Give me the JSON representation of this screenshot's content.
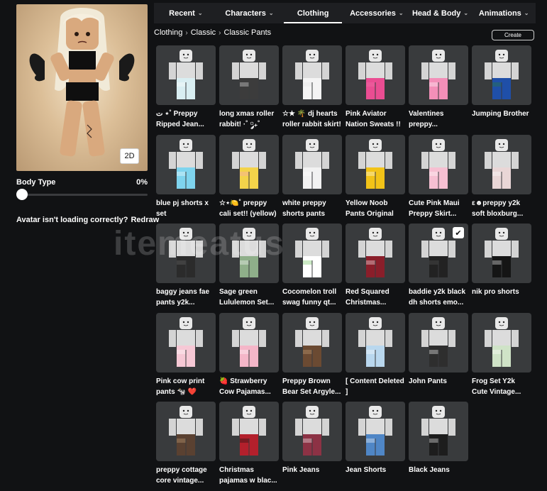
{
  "avatar": {
    "view_toggle": "2D"
  },
  "body_type": {
    "label": "Body Type",
    "value": "0%",
    "level": 0
  },
  "notice": {
    "text": "Avatar isn't loading correctly?",
    "redraw": "Redraw"
  },
  "tabs": [
    {
      "label": "Recent"
    },
    {
      "label": "Characters"
    },
    {
      "label": "Clothing",
      "active": true
    },
    {
      "label": "Accessories"
    },
    {
      "label": "Head & Body"
    },
    {
      "label": "Animations"
    }
  ],
  "breadcrumb": [
    "Clothing",
    "Classic",
    "Classic Pants"
  ],
  "create_label": "Create",
  "items": [
    {
      "name": "ت ⋆˚ Preppy Ripped Jean...",
      "colors": [
        "#d9eef2",
        "#ffffff"
      ]
    },
    {
      "name": "long xmas roller rabbit! ·˚ ༘₊˚",
      "colors": [
        "#3c3c3c",
        "#e8e8e8"
      ]
    },
    {
      "name": "☆★ 🌴 dj hearts roller rabbit skirt!",
      "colors": [
        "#f4f4f4",
        "#e2e2e2"
      ]
    },
    {
      "name": "Pink Aviator Nation Sweats !!",
      "colors": [
        "#ea4d92",
        "#f070a8"
      ]
    },
    {
      "name": "Valentines preppy...",
      "colors": [
        "#f38fb8",
        "#ffffff"
      ]
    },
    {
      "name": "Jumping Brother",
      "colors": [
        "#1f4fa8",
        "#2e7d32"
      ]
    },
    {
      "name": "blue pj shorts x set",
      "colors": [
        "#7fd4ee",
        "#ffffff"
      ]
    },
    {
      "name": "☆⋆🍋˚ preppy cali set!! (yellow)",
      "colors": [
        "#f3d34a",
        "#f6a3c1"
      ]
    },
    {
      "name": "white preppy shorts pants",
      "colors": [
        "#f2f2f2",
        "#ffffff"
      ]
    },
    {
      "name": "Yellow Noob Pants Original",
      "colors": [
        "#f2c318",
        "#ffffff"
      ]
    },
    {
      "name": "Cute Pink Maui Preppy Skirt...",
      "colors": [
        "#f6bfd2",
        "#ffffff"
      ]
    },
    {
      "name": "ε☻preppy y2k soft bloxburg...",
      "colors": [
        "#e9d6d6",
        "#ffffff"
      ]
    },
    {
      "name": "baggy jeans fae pants y2k...",
      "colors": [
        "#2b2b2b",
        "#6a6a6a"
      ]
    },
    {
      "name": "Sage green Lululemon Set...",
      "colors": [
        "#8faf8a",
        "#ffffff"
      ]
    },
    {
      "name": "Cocomelon troll swag funny qt...",
      "colors": [
        "#ffffff",
        "#6bbf59"
      ]
    },
    {
      "name": "Red Squared Christmas...",
      "colors": [
        "#8a1e2a",
        "#ffffff"
      ]
    },
    {
      "name": "baddie y2k black dh shorts emo...",
      "colors": [
        "#222222",
        "#555555"
      ],
      "selected": true
    },
    {
      "name": "nik pro shorts",
      "colors": [
        "#151515",
        "#ffffff"
      ]
    },
    {
      "name": "Pink cow print pants 🐄 ❤️",
      "colors": [
        "#f6c8d5",
        "#ffffff"
      ]
    },
    {
      "name": "🍓 Strawberry Cow Pajamas...",
      "colors": [
        "#f4b6c8",
        "#ffffff"
      ]
    },
    {
      "name": "Preppy Brown Bear Set Argyle...",
      "colors": [
        "#6b4a32",
        "#c9a37a"
      ]
    },
    {
      "name": "[ Content Deleted ]",
      "colors": [
        "#b9d7ee",
        "#ffffff"
      ]
    },
    {
      "name": "John Pants",
      "colors": [
        "#2e2e2e",
        "#ffffff"
      ]
    },
    {
      "name": "Frog Set Y2k Cute Vintage...",
      "colors": [
        "#cfe3c7",
        "#ffffff"
      ]
    },
    {
      "name": "preppy cottage core vintage...",
      "colors": [
        "#5a4131",
        "#c9a37a"
      ]
    },
    {
      "name": "Christmas pajamas w blac...",
      "colors": [
        "#b3202c",
        "#111111"
      ]
    },
    {
      "name": "Pink Jeans",
      "colors": [
        "#8d3245",
        "#ffffff"
      ]
    },
    {
      "name": "Jean Shorts",
      "colors": [
        "#4f86c6",
        "#ffffff"
      ]
    },
    {
      "name": "Black Jeans",
      "colors": [
        "#1d1d1d",
        "#ffffff"
      ]
    }
  ],
  "watermark": "itemeatus"
}
